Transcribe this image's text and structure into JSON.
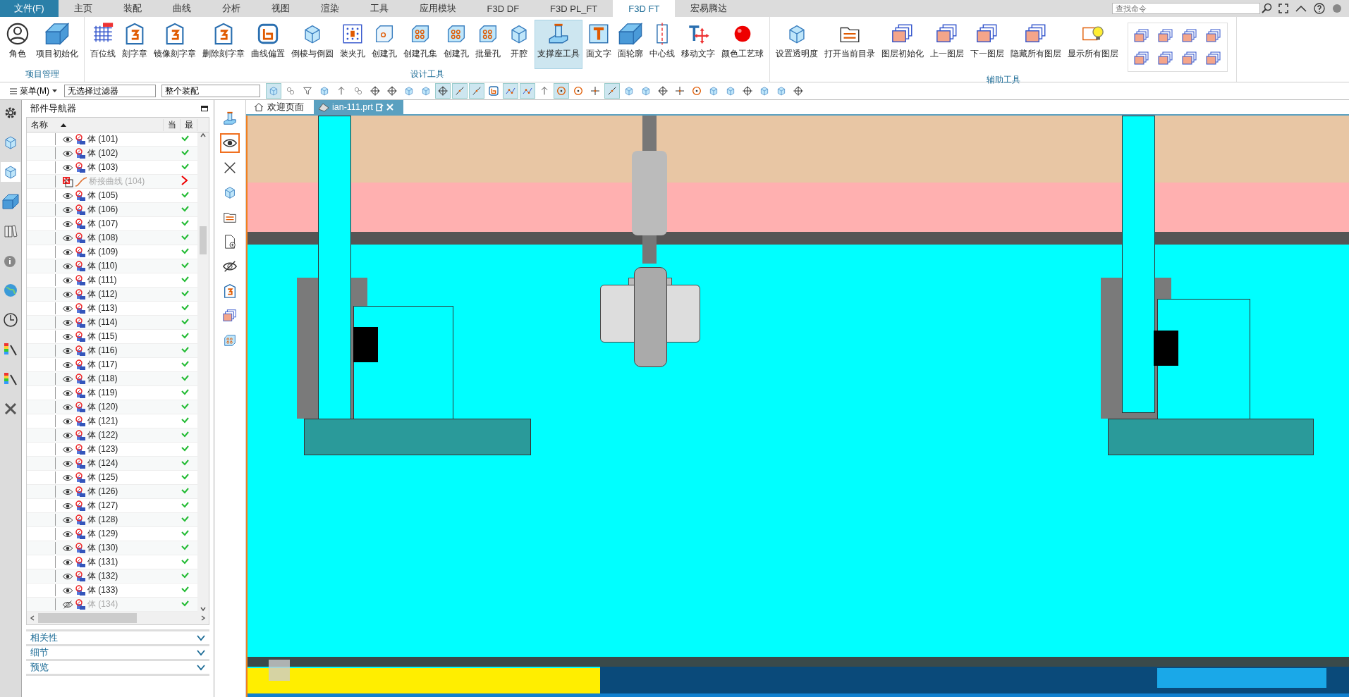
{
  "menu_tabs": [
    {
      "label": "文件(F)",
      "kind": "file",
      "selected": false
    },
    {
      "label": "主页",
      "kind": "tab",
      "selected": false
    },
    {
      "label": "装配",
      "kind": "tab",
      "selected": false
    },
    {
      "label": "曲线",
      "kind": "tab",
      "selected": false
    },
    {
      "label": "分析",
      "kind": "tab",
      "selected": false
    },
    {
      "label": "视图",
      "kind": "tab",
      "selected": false
    },
    {
      "label": "渲染",
      "kind": "tab",
      "selected": false
    },
    {
      "label": "工具",
      "kind": "tab",
      "selected": false
    },
    {
      "label": "应用模块",
      "kind": "tab",
      "selected": false
    },
    {
      "label": "F3D DF",
      "kind": "tab",
      "selected": false
    },
    {
      "label": "F3D PL_FT",
      "kind": "tab",
      "selected": false
    },
    {
      "label": "F3D FT",
      "kind": "tab",
      "selected": true
    },
    {
      "label": "宏易腾达",
      "kind": "tab",
      "selected": false
    }
  ],
  "search": {
    "placeholder": "查找命令"
  },
  "ribbon_groups": [
    {
      "label": "项目管理",
      "tools": [
        {
          "label": "角色",
          "kind": "person",
          "highlighted": false
        },
        {
          "label": "项目初始化",
          "kind": "plate",
          "highlighted": false
        }
      ]
    },
    {
      "label": "设计工具",
      "tools": [
        {
          "label": "百位线",
          "kind": "grid",
          "highlighted": false
        },
        {
          "label": "刻字章",
          "kind": "stamp",
          "highlighted": false
        },
        {
          "label": "镜像刻字章",
          "kind": "stamp",
          "highlighted": false
        },
        {
          "label": "删除刻字章",
          "kind": "stamp",
          "highlighted": false
        },
        {
          "label": "曲线偏置",
          "kind": "curve",
          "highlighted": false
        },
        {
          "label": "倒棱与倒圆",
          "kind": "cube",
          "highlighted": false
        },
        {
          "label": "装夹孔",
          "kind": "dots",
          "highlighted": false
        },
        {
          "label": "创建孔",
          "kind": "hole",
          "highlighted": false
        },
        {
          "label": "创建孔集",
          "kind": "holes",
          "highlighted": false
        },
        {
          "label": "创建孔",
          "kind": "holes",
          "highlighted": false
        },
        {
          "label": "批量孔",
          "kind": "holes",
          "highlighted": false
        },
        {
          "label": "开腔",
          "kind": "cube",
          "highlighted": false
        },
        {
          "label": "支撑座工具",
          "kind": "support",
          "highlighted": true
        },
        {
          "label": "面文字",
          "kind": "text",
          "highlighted": false
        },
        {
          "label": "面轮廓",
          "kind": "plate",
          "highlighted": false
        },
        {
          "label": "中心线",
          "kind": "centerline",
          "highlighted": false
        },
        {
          "label": "移动文字",
          "kind": "move",
          "highlighted": false
        },
        {
          "label": "颜色工艺球",
          "kind": "ball",
          "highlighted": false
        }
      ]
    },
    {
      "label": "辅助工具",
      "tools": [
        {
          "label": "设置透明度",
          "kind": "cube",
          "highlighted": false
        },
        {
          "label": "打开当前目录",
          "kind": "folder",
          "highlighted": false
        },
        {
          "label": "图层初始化",
          "kind": "layers",
          "highlighted": false
        },
        {
          "label": "上一图层",
          "kind": "layers",
          "highlighted": false
        },
        {
          "label": "下一图层",
          "kind": "layers",
          "highlighted": false
        },
        {
          "label": "隐藏所有图层",
          "kind": "layers",
          "highlighted": false
        },
        {
          "label": "显示所有图层",
          "kind": "bulb",
          "highlighted": false
        }
      ]
    }
  ],
  "toolbar": {
    "menu": "菜单(M)",
    "filter": "无选择过滤器",
    "scope": "整个装配",
    "buttons": [
      {
        "kind": "cube",
        "on": true
      },
      {
        "kind": "link",
        "on": false
      },
      {
        "kind": "filter",
        "on": false
      },
      {
        "kind": "cube",
        "on": false
      },
      {
        "kind": "arrow",
        "on": false
      },
      {
        "kind": "link",
        "on": false
      },
      {
        "kind": "target",
        "on": false
      },
      {
        "kind": "target",
        "on": false
      },
      {
        "kind": "cube",
        "on": false
      },
      {
        "kind": "cube",
        "on": false
      },
      {
        "kind": "target",
        "on": true
      },
      {
        "kind": "line",
        "on": true
      },
      {
        "kind": "line",
        "on": true
      },
      {
        "kind": "curve",
        "on": false
      },
      {
        "kind": "polyline",
        "on": true
      },
      {
        "kind": "polyline",
        "on": true
      },
      {
        "kind": "arrow",
        "on": false
      },
      {
        "kind": "circle",
        "on": true
      },
      {
        "kind": "circle",
        "on": false
      },
      {
        "kind": "plus",
        "on": false
      },
      {
        "kind": "line",
        "on": true
      },
      {
        "kind": "cube",
        "on": false
      },
      {
        "kind": "cube",
        "on": false
      },
      {
        "kind": "target",
        "on": false
      },
      {
        "kind": "plus",
        "on": false
      },
      {
        "kind": "circle",
        "on": false
      },
      {
        "kind": "cube",
        "on": false
      },
      {
        "kind": "cube",
        "on": false
      },
      {
        "kind": "target",
        "on": false
      },
      {
        "kind": "cube",
        "on": false
      },
      {
        "kind": "cube",
        "on": false
      },
      {
        "kind": "target",
        "on": false
      }
    ]
  },
  "left_strip": [
    {
      "kind": "gear",
      "selected": false
    },
    {
      "kind": "cube",
      "selected": false
    },
    {
      "kind": "cube",
      "selected": true
    },
    {
      "kind": "plate",
      "selected": false
    },
    {
      "kind": "book",
      "selected": false
    },
    {
      "kind": "info",
      "selected": false
    },
    {
      "kind": "globe",
      "selected": false
    },
    {
      "kind": "clock",
      "selected": false
    },
    {
      "kind": "palette",
      "selected": false
    },
    {
      "kind": "palette",
      "selected": false
    },
    {
      "kind": "tools",
      "selected": false
    }
  ],
  "navigator": {
    "title": "部件导航器",
    "columns": [
      "名称",
      "当",
      "最"
    ],
    "rows": [
      {
        "label": "体 (101)",
        "kind": "body",
        "visible": true,
        "dimmed": false,
        "up_to_date": true
      },
      {
        "label": "体 (102)",
        "kind": "body",
        "visible": true,
        "dimmed": false,
        "up_to_date": true
      },
      {
        "label": "体 (103)",
        "kind": "body",
        "visible": true,
        "dimmed": false,
        "up_to_date": true
      },
      {
        "label": "桥接曲线 (104)",
        "kind": "curve",
        "dimmed": true,
        "up_to_date": false
      },
      {
        "label": "体 (105)",
        "kind": "body",
        "visible": true,
        "dimmed": false,
        "up_to_date": true
      },
      {
        "label": "体 (106)",
        "kind": "body",
        "visible": true,
        "dimmed": false,
        "up_to_date": true
      },
      {
        "label": "体 (107)",
        "kind": "body",
        "visible": true,
        "dimmed": false,
        "up_to_date": true
      },
      {
        "label": "体 (108)",
        "kind": "body",
        "visible": true,
        "dimmed": false,
        "up_to_date": true
      },
      {
        "label": "体 (109)",
        "kind": "body",
        "visible": true,
        "dimmed": false,
        "up_to_date": true
      },
      {
        "label": "体 (110)",
        "kind": "body",
        "visible": true,
        "dimmed": false,
        "up_to_date": true
      },
      {
        "label": "体 (111)",
        "kind": "body",
        "visible": true,
        "dimmed": false,
        "up_to_date": true
      },
      {
        "label": "体 (112)",
        "kind": "body",
        "visible": true,
        "dimmed": false,
        "up_to_date": true
      },
      {
        "label": "体 (113)",
        "kind": "body",
        "visible": true,
        "dimmed": false,
        "up_to_date": true
      },
      {
        "label": "体 (114)",
        "kind": "body",
        "visible": true,
        "dimmed": false,
        "up_to_date": true
      },
      {
        "label": "体 (115)",
        "kind": "body",
        "visible": true,
        "dimmed": false,
        "up_to_date": true
      },
      {
        "label": "体 (116)",
        "kind": "body",
        "visible": true,
        "dimmed": false,
        "up_to_date": true
      },
      {
        "label": "体 (117)",
        "kind": "body",
        "visible": true,
        "dimmed": false,
        "up_to_date": true
      },
      {
        "label": "体 (118)",
        "kind": "body",
        "visible": true,
        "dimmed": false,
        "up_to_date": true
      },
      {
        "label": "体 (119)",
        "kind": "body",
        "visible": true,
        "dimmed": false,
        "up_to_date": true
      },
      {
        "label": "体 (120)",
        "kind": "body",
        "visible": true,
        "dimmed": false,
        "up_to_date": true
      },
      {
        "label": "体 (121)",
        "kind": "body",
        "visible": true,
        "dimmed": false,
        "up_to_date": true
      },
      {
        "label": "体 (122)",
        "kind": "body",
        "visible": true,
        "dimmed": false,
        "up_to_date": true
      },
      {
        "label": "体 (123)",
        "kind": "body",
        "visible": true,
        "dimmed": false,
        "up_to_date": true
      },
      {
        "label": "体 (124)",
        "kind": "body",
        "visible": true,
        "dimmed": false,
        "up_to_date": true
      },
      {
        "label": "体 (125)",
        "kind": "body",
        "visible": true,
        "dimmed": false,
        "up_to_date": true
      },
      {
        "label": "体 (126)",
        "kind": "body",
        "visible": true,
        "dimmed": false,
        "up_to_date": true
      },
      {
        "label": "体 (127)",
        "kind": "body",
        "visible": true,
        "dimmed": false,
        "up_to_date": true
      },
      {
        "label": "体 (128)",
        "kind": "body",
        "visible": true,
        "dimmed": false,
        "up_to_date": true
      },
      {
        "label": "体 (129)",
        "kind": "body",
        "visible": true,
        "dimmed": false,
        "up_to_date": true
      },
      {
        "label": "体 (130)",
        "kind": "body",
        "visible": true,
        "dimmed": false,
        "up_to_date": true
      },
      {
        "label": "体 (131)",
        "kind": "body",
        "visible": true,
        "dimmed": false,
        "up_to_date": true
      },
      {
        "label": "体 (132)",
        "kind": "body",
        "visible": true,
        "dimmed": false,
        "up_to_date": true
      },
      {
        "label": "体 (133)",
        "kind": "body",
        "visible": true,
        "dimmed": false,
        "up_to_date": true
      },
      {
        "label": "体 (134)",
        "kind": "body",
        "visible": false,
        "dimmed": true,
        "up_to_date": true
      }
    ],
    "panels": [
      {
        "label": "相关性",
        "expanded": false
      },
      {
        "label": "细节",
        "expanded": false
      },
      {
        "label": "预览",
        "expanded": false
      }
    ]
  },
  "side_tools": [
    {
      "kind": "support",
      "selected": false
    },
    {
      "kind": "eye",
      "selected": true
    },
    {
      "kind": "cross",
      "selected": false
    },
    {
      "kind": "cube",
      "selected": false
    },
    {
      "kind": "folder",
      "selected": false
    },
    {
      "kind": "doc",
      "selected": false
    },
    {
      "kind": "eyeoff",
      "selected": false
    },
    {
      "kind": "stamp",
      "selected": false
    },
    {
      "kind": "layers",
      "selected": false
    },
    {
      "kind": "holes",
      "selected": false
    }
  ],
  "doc_tabs": [
    {
      "label": "欢迎页面",
      "kind": "home",
      "selected": false
    },
    {
      "label": "ian-111.prt",
      "kind": "part",
      "selected": true
    }
  ]
}
